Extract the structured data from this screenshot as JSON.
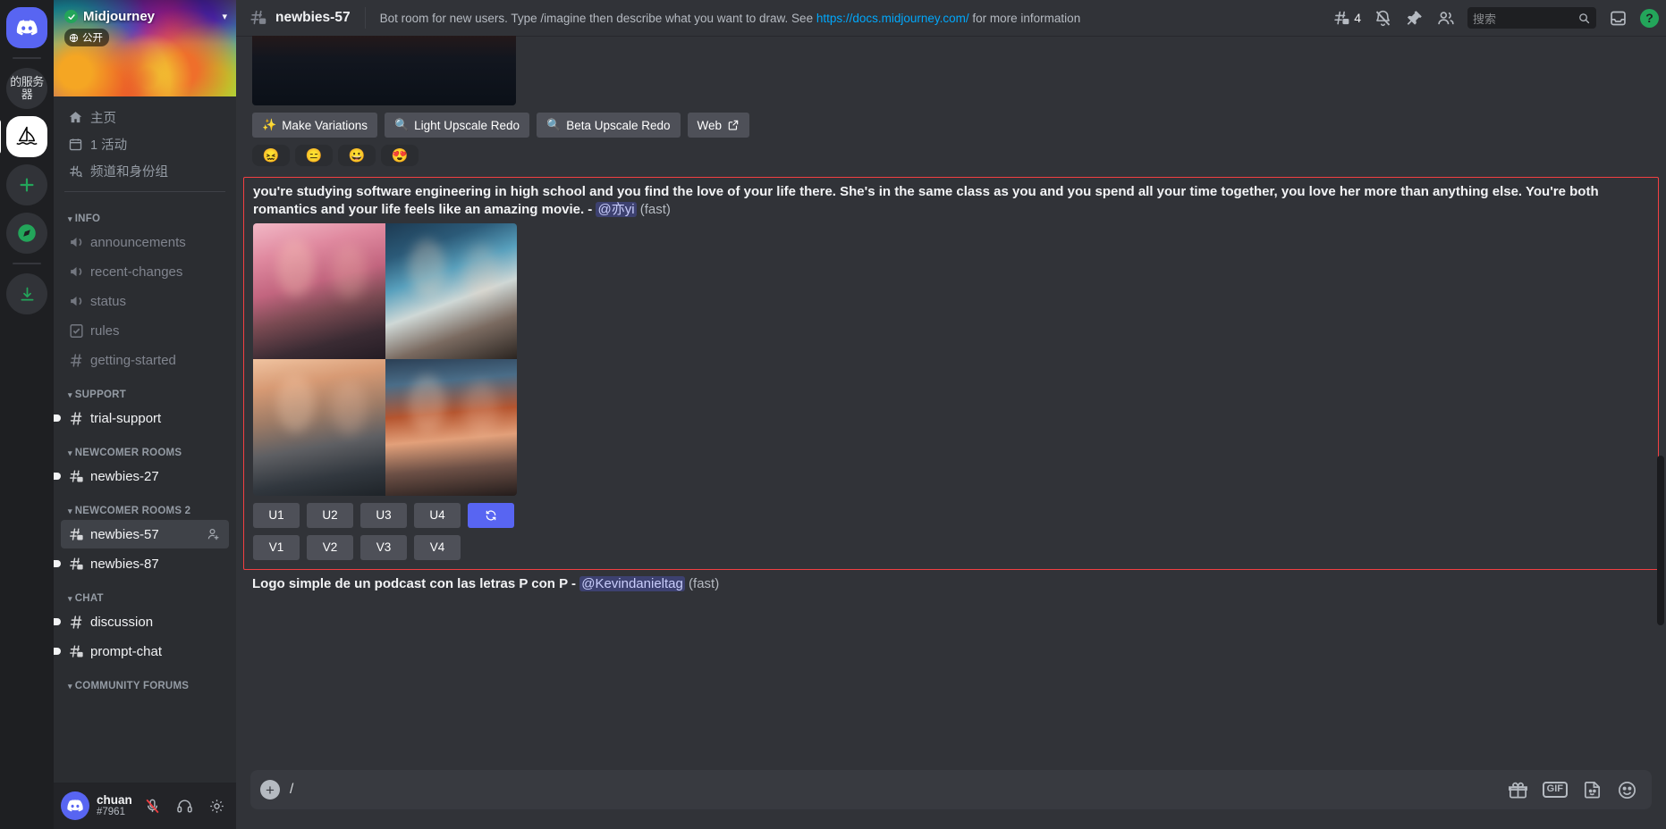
{
  "rail": {
    "items": [
      {
        "name": "discord-home",
        "label": "",
        "icon": "discord-logo"
      },
      {
        "name": "server-folder",
        "label": "的服务器",
        "icon": "folder"
      },
      {
        "name": "server-midjourney",
        "label": "",
        "icon": "sailboat"
      },
      {
        "name": "add-server",
        "label": "+",
        "icon": "plus"
      },
      {
        "name": "explore-servers",
        "label": "",
        "icon": "compass"
      },
      {
        "name": "download-apps",
        "label": "",
        "icon": "download"
      }
    ]
  },
  "sidebar": {
    "server_name": "Midjourney",
    "public_badge": "公开",
    "nav": [
      {
        "label": "主页",
        "icon": "home-icon"
      },
      {
        "label": "1 活动",
        "icon": "calendar-icon"
      },
      {
        "label": "频道和身份组",
        "icon": "channels-roles-icon"
      }
    ],
    "categories": [
      {
        "label": "INFO",
        "channels": [
          {
            "label": "announcements",
            "icon": "announcement-icon",
            "state": "read"
          },
          {
            "label": "recent-changes",
            "icon": "announcement-icon",
            "state": "read"
          },
          {
            "label": "status",
            "icon": "announcement-icon",
            "state": "read"
          },
          {
            "label": "rules",
            "icon": "rules-icon",
            "state": "read"
          },
          {
            "label": "getting-started",
            "icon": "hash-icon",
            "state": "read"
          }
        ]
      },
      {
        "label": "SUPPORT",
        "channels": [
          {
            "label": "trial-support",
            "icon": "hash-icon",
            "state": "unread"
          }
        ]
      },
      {
        "label": "NEWCOMER ROOMS",
        "channels": [
          {
            "label": "newbies-27",
            "icon": "hash-thread-icon",
            "state": "unread"
          }
        ]
      },
      {
        "label": "NEWCOMER ROOMS 2",
        "channels": [
          {
            "label": "newbies-57",
            "icon": "hash-thread-icon",
            "state": "selected"
          },
          {
            "label": "newbies-87",
            "icon": "hash-thread-icon",
            "state": "unread"
          }
        ]
      },
      {
        "label": "CHAT",
        "channels": [
          {
            "label": "discussion",
            "icon": "hash-icon",
            "state": "unread"
          },
          {
            "label": "prompt-chat",
            "icon": "hash-thread-icon",
            "state": "unread"
          }
        ]
      },
      {
        "label": "COMMUNITY FORUMS",
        "channels": []
      }
    ],
    "user": {
      "name": "chuan",
      "tag": "#7961",
      "mic_icon": "mic-muted-icon",
      "headset_icon": "headset-icon",
      "settings_icon": "gear-icon"
    }
  },
  "topbar": {
    "channel_name": "newbies-57",
    "topic_before": "Bot room for new users. Type /imagine then describe what you want to draw. See ",
    "topic_link": "https://docs.midjourney.com/",
    "topic_after": " for more information",
    "threads_count": "4",
    "search_placeholder": "搜索",
    "icons": [
      "threads-icon",
      "notification-muted-icon",
      "pin-icon",
      "members-icon",
      "inbox-icon",
      "help-icon"
    ]
  },
  "messages": {
    "top_message": {
      "buttons": [
        {
          "label": "Make Variations",
          "icon": "sparkles-icon"
        },
        {
          "label": "Light Upscale Redo",
          "icon": "magnifier-icon"
        },
        {
          "label": "Beta Upscale Redo",
          "icon": "magnifier-icon"
        },
        {
          "label": "Web",
          "icon": "external-link-icon"
        }
      ],
      "reactions": [
        "😖",
        "😑",
        "😀",
        "😍"
      ]
    },
    "highlighted_message": {
      "text_line1": "you're studying software engineering in high school and you find the love of your life there. She's in the same class as you and you spend all your time together, you love her more than anything else.",
      "text_line2": "You're both romantics and your life feels like an amazing movie.",
      "dash": " - ",
      "mention": "@亦yi",
      "speed": "(fast)",
      "upscale_buttons": [
        "U1",
        "U2",
        "U3",
        "U4"
      ],
      "variation_buttons": [
        "V1",
        "V2",
        "V3",
        "V4"
      ],
      "reroll_icon": "refresh-icon"
    },
    "bottom_message": {
      "text": "Logo simple de un podcast con las letras P con P",
      "dash": " - ",
      "mention": "@Kevindanieltag",
      "speed": "(fast)"
    }
  },
  "composer": {
    "value": "/",
    "add_icon": "plus-circle-icon",
    "icons": [
      "gift-icon",
      "gif-icon",
      "sticker-icon",
      "emoji-icon"
    ],
    "gif_label": "GIF"
  }
}
